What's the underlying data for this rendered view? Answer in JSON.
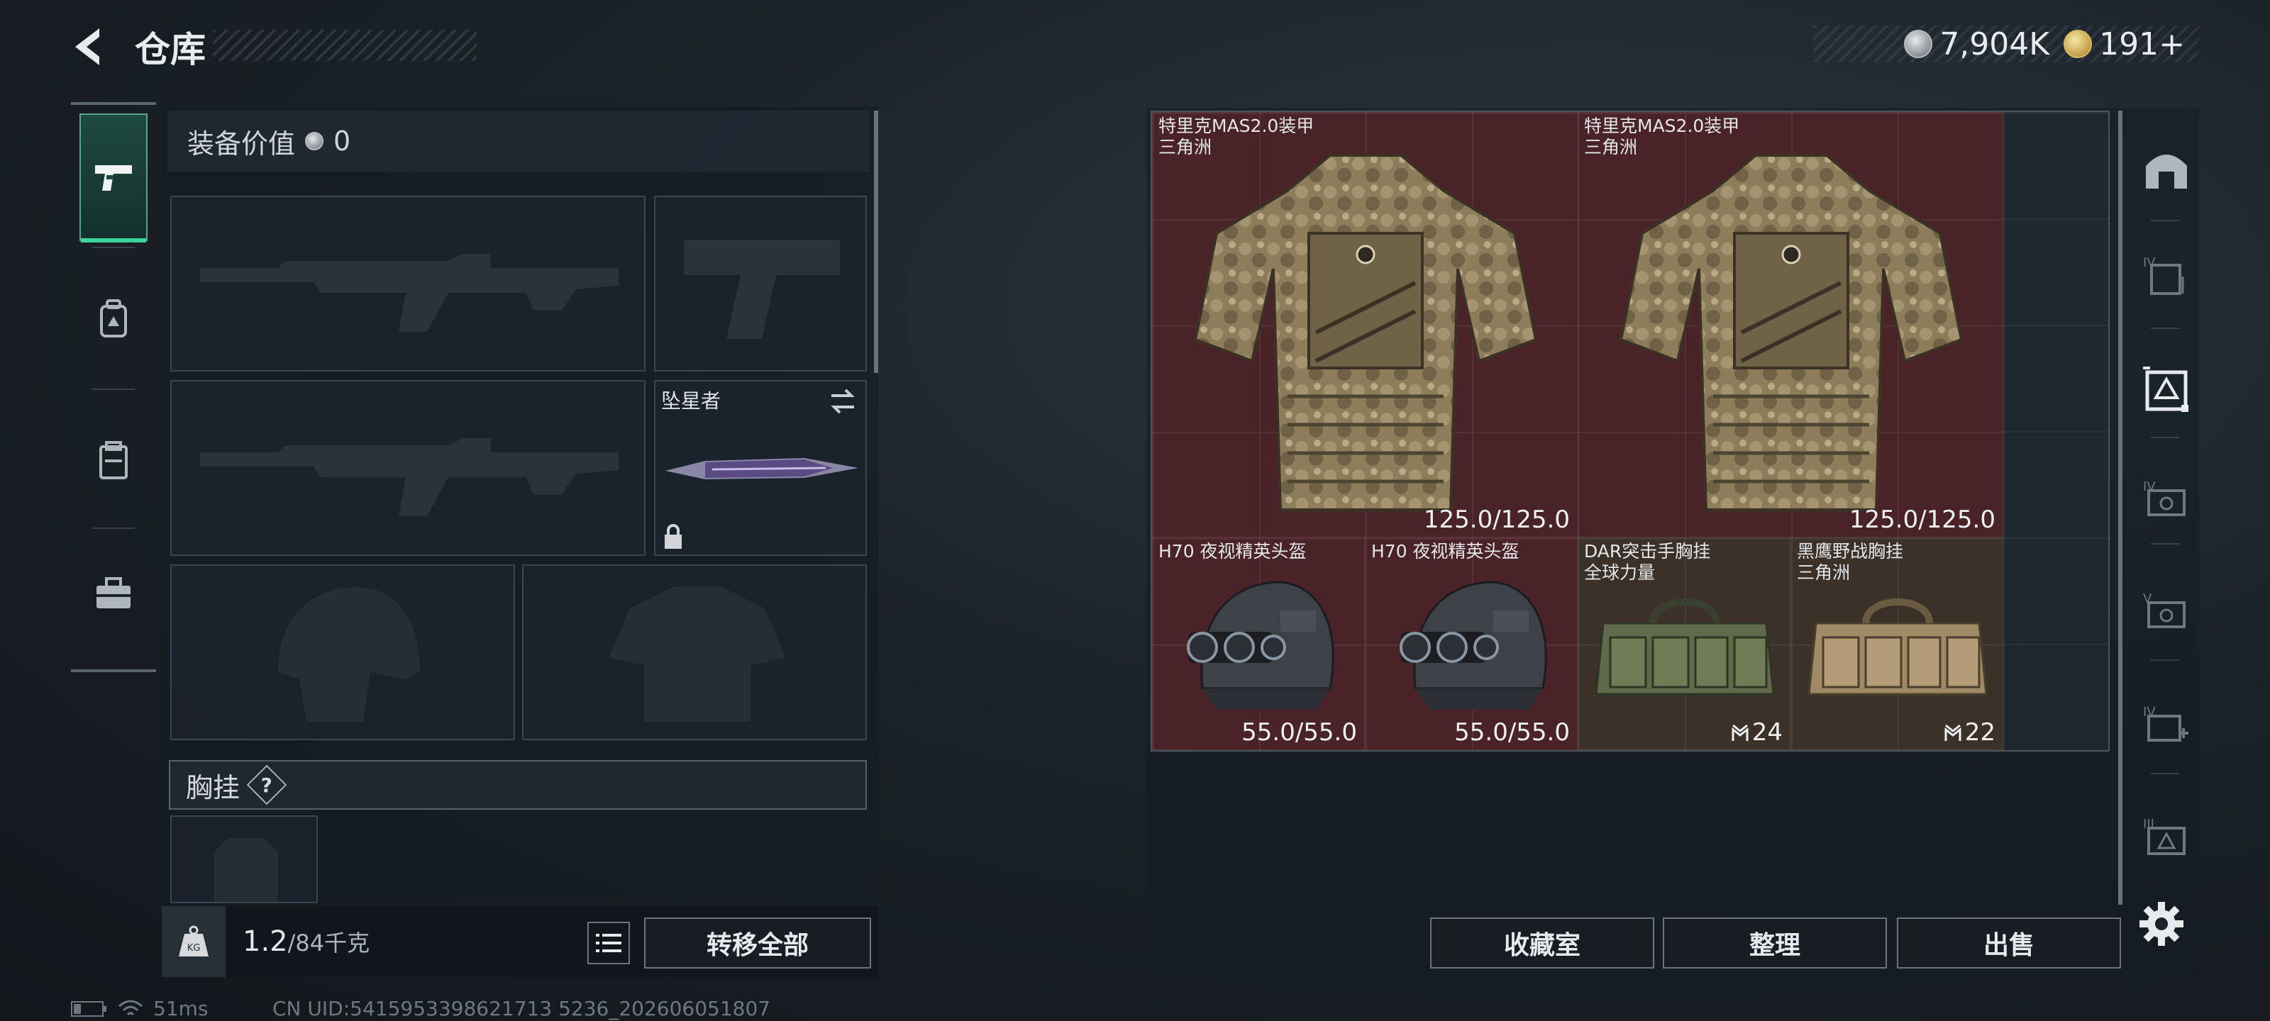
{
  "header": {
    "title": "仓库",
    "currency_silver": "7,904K",
    "currency_gold": "191+"
  },
  "loadout": {
    "value_label": "装备价值",
    "value": "0",
    "melee_name": "坠星者",
    "chest_label": "胸挂",
    "help": "?",
    "weight_current": "1.2",
    "weight_max": "/84千克",
    "transfer_all": "转移全部"
  },
  "left_tabs": [
    "weapon-tab",
    "backpack-tab",
    "vest-tab",
    "case-tab"
  ],
  "storage": {
    "items": [
      {
        "name1": "特里克MAS2.0装甲",
        "name2": "三角洲",
        "stat": "125.0/125.0",
        "color": "red",
        "kind": "armor"
      },
      {
        "name1": "特里克MAS2.0装甲",
        "name2": "三角洲",
        "stat": "125.0/125.0",
        "color": "red",
        "kind": "armor"
      },
      {
        "name1": "H70 夜视精英头盔",
        "name2": "",
        "stat": "55.0/55.0",
        "color": "red",
        "kind": "helmet"
      },
      {
        "name1": "H70 夜视精英头盔",
        "name2": "",
        "stat": "55.0/55.0",
        "color": "red",
        "kind": "helmet"
      },
      {
        "name1": "DAR突击手胸挂",
        "name2": "全球力量",
        "stat": "24",
        "color": "tan",
        "kind": "rig-green"
      },
      {
        "name1": "黑鹰野战胸挂",
        "name2": "三角洲",
        "stat": "22",
        "color": "tan",
        "kind": "rig-tan"
      }
    ],
    "buttons": {
      "collection": "收藏室",
      "organize": "整理",
      "sell": "出售"
    }
  },
  "status": {
    "ping": "51ms",
    "uid": "CN UID:5415953398621713 5236_202606051807"
  }
}
